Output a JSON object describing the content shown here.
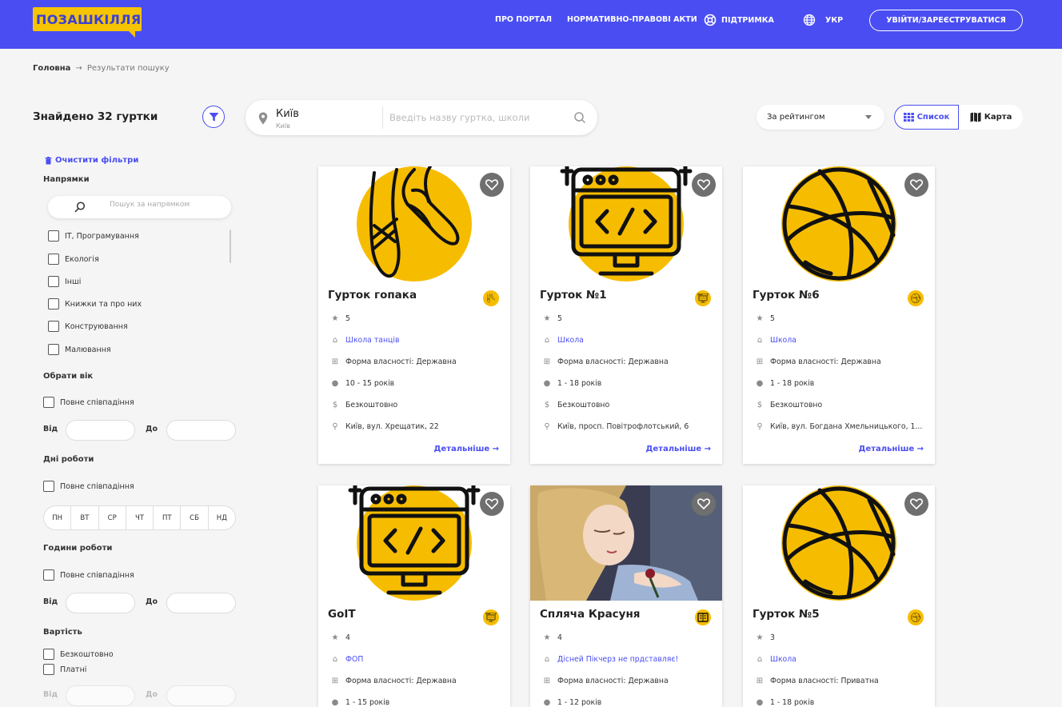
{
  "header": {
    "logo": "ПОЗАШКІЛЛЯ",
    "nav": {
      "about": "ПРО ПОРТАЛ",
      "acts": "НОРМАТИВНО-ПРАВОВІ АКТИ",
      "support": "ПІДТРИМКА",
      "lang": "УКР"
    },
    "login": "УВІЙТИ/ЗАРЕЄСТРУВАТИСЯ"
  },
  "breadcrumb": {
    "home": "Головна",
    "current": "Результати пошуку"
  },
  "results": {
    "found": "Знайдено 32 гуртки"
  },
  "search": {
    "city": "Київ",
    "city_sub": "Київ",
    "placeholder": "Введіть назву гуртка, школи"
  },
  "sort": {
    "selected": "За рейтингом"
  },
  "view": {
    "list": "Список",
    "map": "Карта"
  },
  "filters": {
    "clear": "Очистити фільтри",
    "directions_title": "Напрямки",
    "directions_placeholder": "Пошук за напрямком",
    "directions": [
      "IT, Програмування",
      "Екологія",
      "Інші",
      "Книжки та про них",
      "Конструювання",
      "Малювання"
    ],
    "age_title": "Обрати вік",
    "full_match": "Повне співпадіння",
    "from": "Від",
    "to": "До",
    "days_title": "Дні роботи",
    "days": [
      "ПН",
      "ВТ",
      "СР",
      "ЧТ",
      "ПТ",
      "СБ",
      "НД"
    ],
    "hours_title": "Години роботи",
    "price_title": "Вартість",
    "price_options": [
      "Безкоштовно",
      "Платні"
    ]
  },
  "more_label": "Детальніше",
  "cards": [
    {
      "title": "Гурток гопака",
      "rating": "5",
      "school": "Школа танців",
      "ownership": "Форма власності: Державна",
      "age": "10 - 15 років",
      "price": "Безкоштовно",
      "address": "Київ, вул. Хрещатик, 22",
      "image": "ballet-shoes-icon"
    },
    {
      "title": "Гурток №1",
      "rating": "5",
      "school": "Школа",
      "ownership": "Форма власності: Державна",
      "age": "1 - 18 років",
      "price": "Безкоштовно",
      "address": "Київ, просп. Повітрофлотський, 6",
      "image": "code-monitor-icon"
    },
    {
      "title": "Гурток №6",
      "rating": "5",
      "school": "Школа",
      "ownership": "Форма власності: Державна",
      "age": "1 - 18 років",
      "price": "Безкоштовно",
      "address": "Київ, вул. Богдана Хмельницького, 1...",
      "image": "basketball-icon"
    },
    {
      "title": "GoIT",
      "rating": "4",
      "school": "ФОП",
      "ownership": "Форма власності: Державна",
      "age": "1 - 15 років",
      "image": "code-monitor-icon"
    },
    {
      "title": "Спляча Красуня",
      "rating": "4",
      "school": "Дісней Пікчерз не прдставляє!",
      "ownership": "Форма власності: Державна",
      "age": "1 - 12 років",
      "image": "sleeping-beauty-photo"
    },
    {
      "title": "Гурток №5",
      "rating": "3",
      "school": "Школа",
      "ownership": "Форма власності: Приватна",
      "age": "1 - 18 років",
      "image": "basketball-icon"
    }
  ],
  "colors": {
    "primary": "#4a4ef2",
    "accent": "#f6bd00",
    "background": "#f5f5f6"
  }
}
